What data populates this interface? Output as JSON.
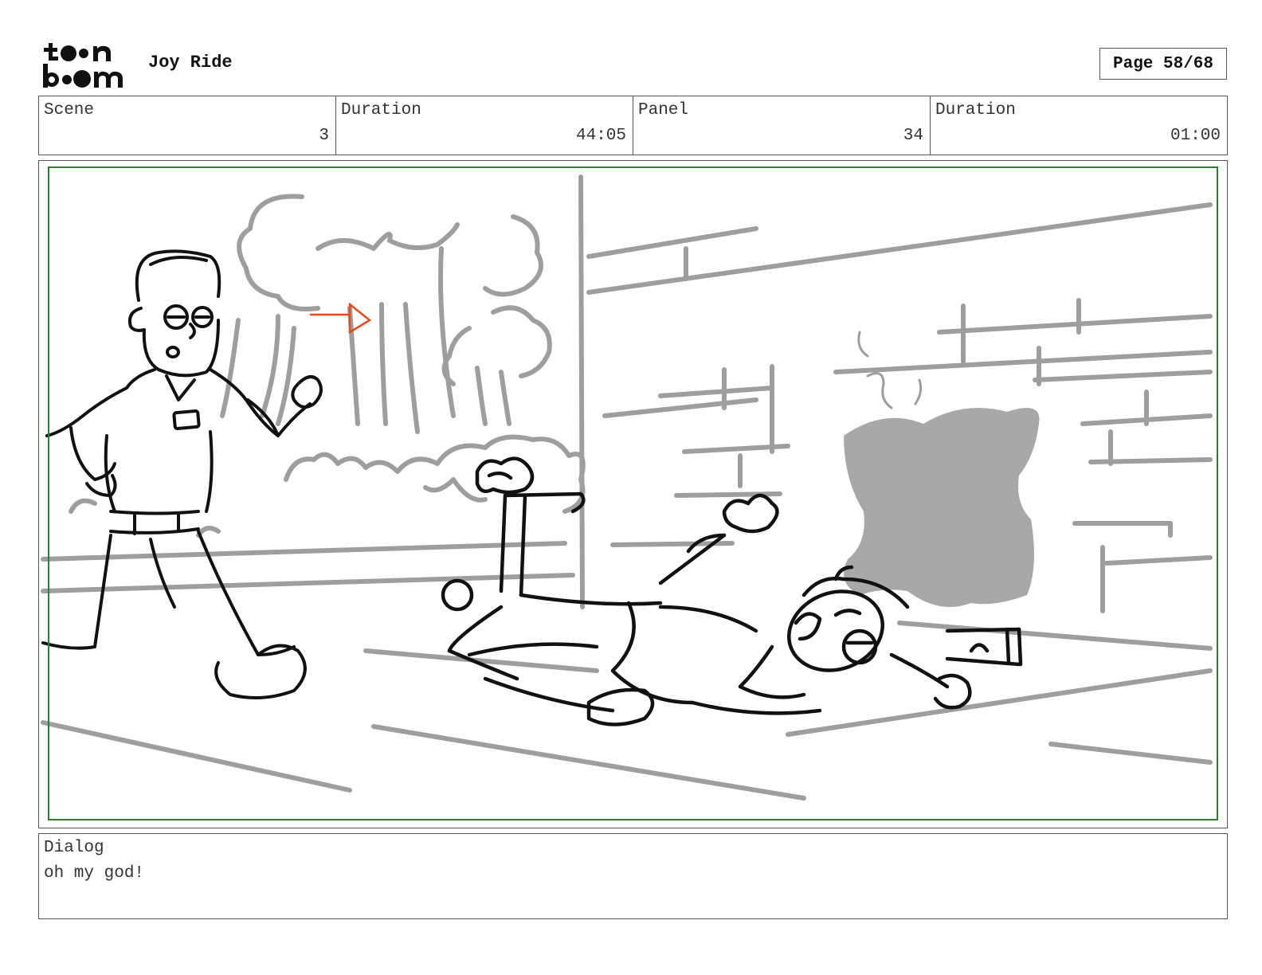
{
  "header": {
    "logo_text": "toon boom",
    "project_title": "Joy Ride",
    "page": "Page 58/68"
  },
  "info": {
    "scene_label": "Scene",
    "scene_value": "3",
    "scene_duration_label": "Duration",
    "scene_duration_value": "44:05",
    "panel_label": "Panel",
    "panel_value": "34",
    "panel_duration_label": "Duration",
    "panel_duration_value": "01:00"
  },
  "panel": {
    "safe_frame_color": "#2e7d32",
    "sketch_colors": {
      "ink": "#111111",
      "background": "#9e9e9e",
      "tone": "#a8a8a8",
      "marker": "#e64a19"
    }
  },
  "dialog": {
    "label": "Dialog",
    "text": "oh my god!"
  }
}
